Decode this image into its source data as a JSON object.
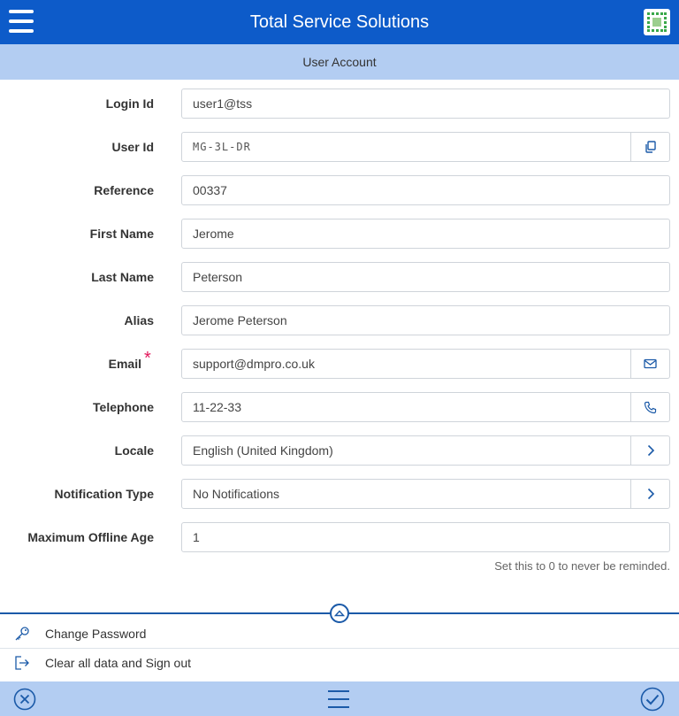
{
  "header": {
    "title": "Total Service Solutions"
  },
  "subheader": {
    "title": "User Account"
  },
  "form": {
    "fields": [
      {
        "label": "Login Id",
        "value": "user1@tss"
      },
      {
        "label": "User Id",
        "value": "MG-3L-DR"
      },
      {
        "label": "Reference",
        "value": "00337"
      },
      {
        "label": "First Name",
        "value": "Jerome"
      },
      {
        "label": "Last Name",
        "value": "Peterson"
      },
      {
        "label": "Alias",
        "value": "Jerome Peterson"
      },
      {
        "label": "Email",
        "value": "support@dmpro.co.uk"
      },
      {
        "label": "Telephone",
        "value": "11-22-33"
      },
      {
        "label": "Locale",
        "value": "English (United Kingdom)"
      },
      {
        "label": "Notification Type",
        "value": "No Notifications"
      },
      {
        "label": "Maximum Offline Age",
        "value": "1"
      }
    ],
    "required_marker": "*",
    "offline_hint": "Set this to 0 to never be reminded."
  },
  "actions": {
    "change_password": "Change Password",
    "clear_sign_out": "Clear all data and Sign out"
  },
  "colors": {
    "header_bg": "#0d5bc9",
    "subheader_bg": "#b3cdf2",
    "accent": "#1b5aa8",
    "required": "#e2185b"
  },
  "icons": {
    "menu": "hamburger-icon",
    "logo": "app-logo",
    "copy": "copy-icon",
    "email": "envelope-icon",
    "phone": "phone-icon",
    "chevron": "chevron-right-icon",
    "collapse": "chevron-up-icon",
    "key": "key-icon",
    "signout": "sign-out-icon",
    "cancel": "close-circle-icon",
    "list": "list-icon",
    "confirm": "check-circle-icon"
  }
}
